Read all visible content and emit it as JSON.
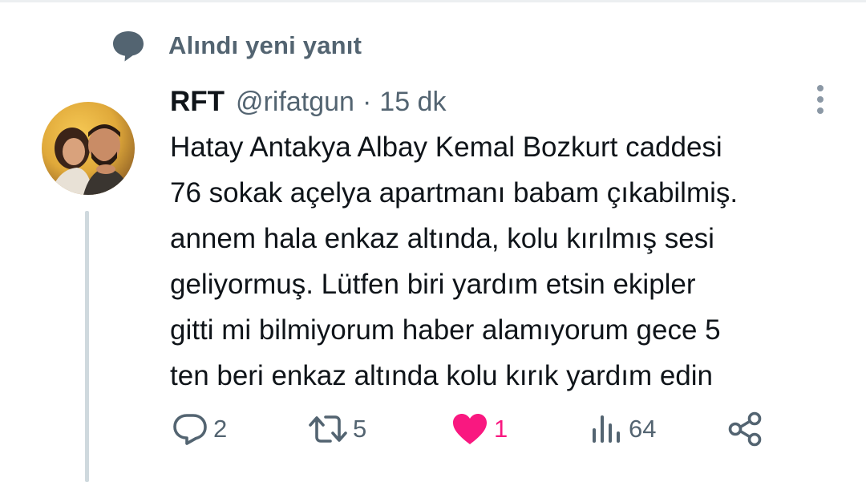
{
  "notification": {
    "title": "Alındı yeni yanıt",
    "icon": "speech-bubble-icon"
  },
  "tweet": {
    "author": {
      "name": "RFT",
      "handle": "@rifatgun",
      "avatar_icon": "user-avatar-photo"
    },
    "separator": "·",
    "time": "15 dk",
    "text_lines": [
      "Hatay Antakya Albay Kemal Bozkurt caddesi",
      "76 sokak açelya apartmanı babam çıkabilmiş.",
      "annem hala enkaz altında, kolu kırılmış sesi",
      "geliyormuş. Lütfen biri yardım etsin ekipler",
      "gitti mi bilmiyorum haber alamıyorum gece 5",
      "ten beri enkaz altında kolu kırık yardım edin"
    ],
    "actions": {
      "reply": {
        "count": "2",
        "icon": "reply-icon"
      },
      "retweet": {
        "count": "5",
        "icon": "retweet-icon"
      },
      "like": {
        "count": "1",
        "icon": "heart-icon",
        "liked": true
      },
      "views": {
        "count": "64",
        "icon": "views-icon"
      },
      "share": {
        "icon": "share-icon"
      }
    },
    "more_icon": "more-vertical-icon"
  },
  "colors": {
    "text_primary": "#0f1419",
    "text_secondary": "#536471",
    "like_active": "#f91880",
    "thread_line": "#cfd9de"
  }
}
